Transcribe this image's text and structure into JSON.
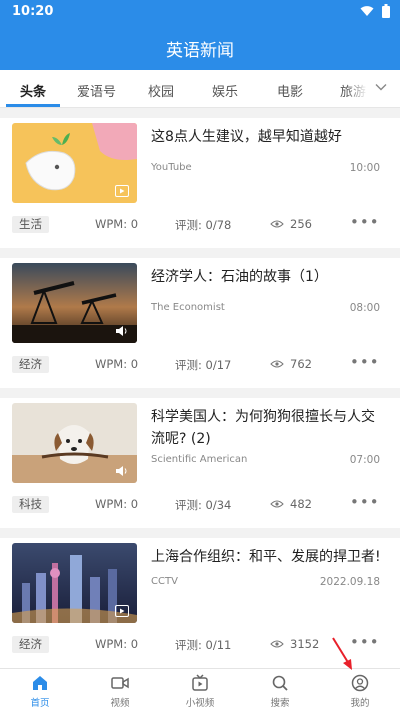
{
  "status_bar": {
    "time": "10:20"
  },
  "header": {
    "title": "英语新闻"
  },
  "tabs": [
    {
      "label": "头条"
    },
    {
      "label": "爱语号"
    },
    {
      "label": "校园"
    },
    {
      "label": "娱乐"
    },
    {
      "label": "电影"
    },
    {
      "label": "旅游"
    }
  ],
  "articles": [
    {
      "title": "这8点人生建议，越早知道越好",
      "source": "YouTube",
      "time": "10:00",
      "tag": "生活",
      "wpm": "WPM: 0",
      "score": "评测: 0/78",
      "views": "256",
      "media": "video"
    },
    {
      "title": "经济学人：石油的故事（1）",
      "source": "The Economist",
      "time": "08:00",
      "tag": "经济",
      "wpm": "WPM: 0",
      "score": "评测: 0/17",
      "views": "762",
      "media": "audio"
    },
    {
      "title": "科学美国人：为何狗狗很擅长与人交流呢? (2)",
      "source": "Scientific American",
      "time": "07:00",
      "tag": "科技",
      "wpm": "WPM: 0",
      "score": "评测: 0/34",
      "views": "482",
      "media": "audio"
    },
    {
      "title": "上海合作组织：和平、发展的捍卫者!",
      "source": "CCTV",
      "time": "2022.09.18",
      "tag": "经济",
      "wpm": "WPM: 0",
      "score": "评测: 0/11",
      "views": "3152",
      "media": "video"
    }
  ],
  "more_label": "•••",
  "bottom_nav": [
    {
      "label": "首页",
      "icon": "home-icon",
      "active": true
    },
    {
      "label": "视频",
      "icon": "video-icon"
    },
    {
      "label": "小视频",
      "icon": "short-video-icon"
    },
    {
      "label": "搜索",
      "icon": "search-icon"
    },
    {
      "label": "我的",
      "icon": "profile-icon"
    }
  ],
  "colors": {
    "brand": "#2b8ce8",
    "annotation": "#e8202a"
  }
}
